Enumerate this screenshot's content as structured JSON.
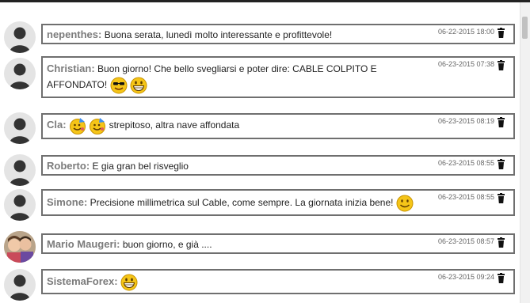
{
  "comments": [
    {
      "author": "nepenthes:",
      "message": "Buona serata, lunedì molto interessante e profittevole!",
      "timestamp": "06-22-2015 18:00"
    },
    {
      "author": "Christian:",
      "message": "Buon giorno! Che bello svegliarsi e poter dire: CABLE COLPITO E AFFONDATO!",
      "timestamp": "06-23-2015 07:38",
      "emoticons": [
        "sunglasses-smiley-icon",
        "grin-smiley-icon"
      ]
    },
    {
      "author": "Cla:",
      "message": "strepitoso, altra nave affondata",
      "timestamp": "06-23-2015 08:19",
      "emoticons": [
        "party-smiley-icon",
        "party-smiley-icon"
      ]
    },
    {
      "author": "Roberto:",
      "message": "E gia gran bel risveglio",
      "timestamp": "06-23-2015 08:55"
    },
    {
      "author": "Simone:",
      "message": "Precisione millimetrica sul Cable, come sempre. La giornata inizia bene!",
      "timestamp": "06-23-2015 08:55",
      "emoticons": [
        "smile-smiley-icon"
      ]
    },
    {
      "author": "Mario Maugeri:",
      "message": "buon giorno, e già ....",
      "timestamp": "06-23-2015 08:57",
      "avatar": "photo"
    },
    {
      "author": "SistemaForex:",
      "message": "",
      "timestamp": "06-23-2015 09:24",
      "emoticons": [
        "grin-smiley-icon"
      ]
    }
  ]
}
